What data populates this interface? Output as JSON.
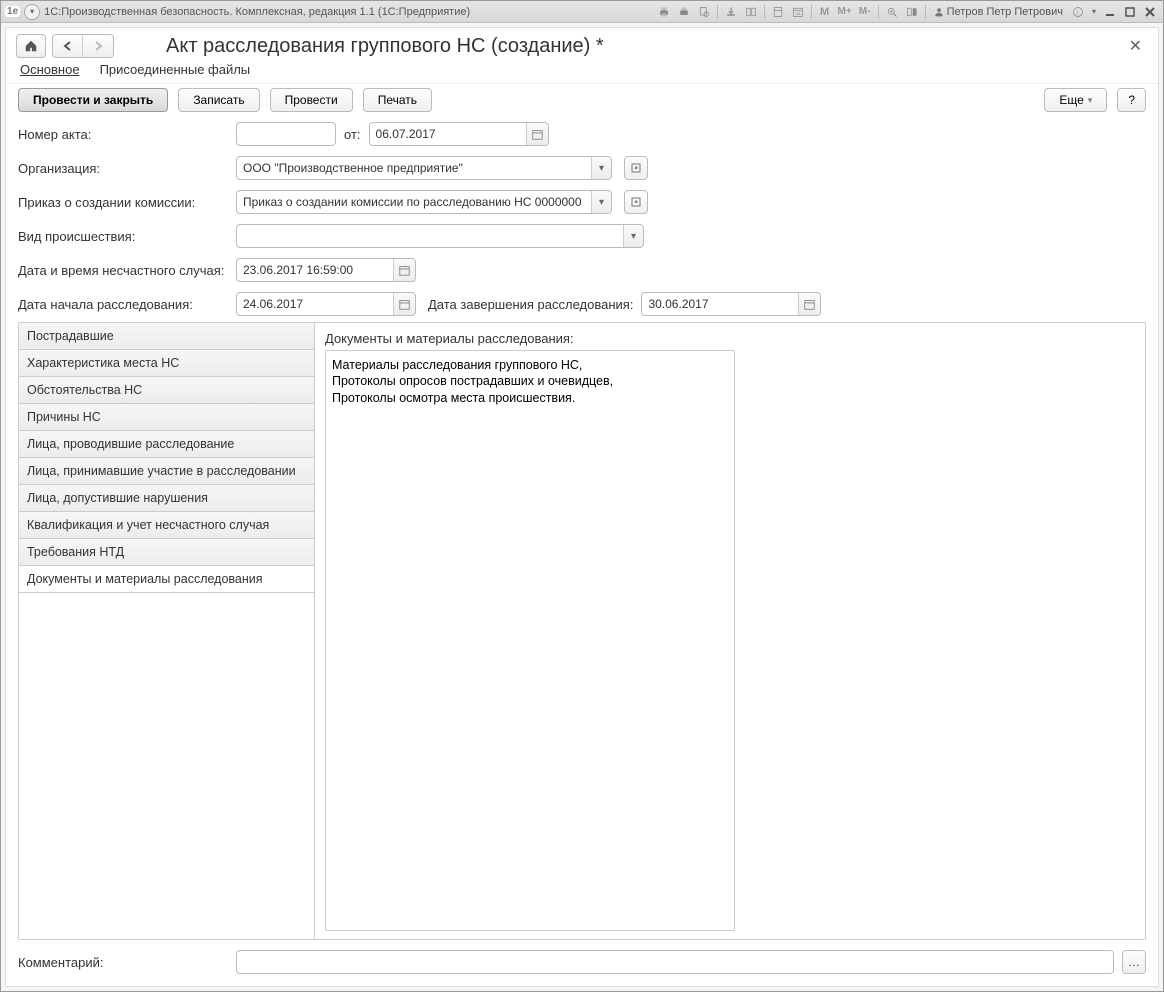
{
  "titlebar": {
    "app_title": "1С:Производственная безопасность. Комплексная, редакция 1.1  (1С:Предприятие)",
    "user_name": "Петров Петр Петрович",
    "m1": "M",
    "m2": "M+",
    "m3": "M-"
  },
  "page": {
    "title": "Акт расследования группового НС (создание) *"
  },
  "section_tabs": {
    "main": "Основное",
    "files": "Присоединенные файлы"
  },
  "toolbar": {
    "post_close": "Провести и закрыть",
    "save": "Записать",
    "post": "Провести",
    "print": "Печать",
    "more": "Еще",
    "help": "?"
  },
  "form": {
    "act_number_label": "Номер акта:",
    "act_number_value": "",
    "from_label": "от:",
    "from_date": "06.07.2017",
    "org_label": "Организация:",
    "org_value": "ООО \"Производственное предприятие\"",
    "order_label": "Приказ о создании комиссии:",
    "order_value": "Приказ о создании комиссии по расследованию НС 0000000",
    "incident_type_label": "Вид происшествия:",
    "incident_type_value": "",
    "datetime_label": "Дата и время несчастного случая:",
    "datetime_value": "23.06.2017 16:59:00",
    "start_label": "Дата начала расследования:",
    "start_value": "24.06.2017",
    "end_label": "Дата завершения расследования:",
    "end_value": "30.06.2017"
  },
  "tabs": [
    "Пострадавшие",
    "Характеристика места НС",
    "Обстоятельства НС",
    "Причины НС",
    "Лица, проводившие расследование",
    "Лица, принимавшие участие в расследовании",
    "Лица, допустившие нарушения",
    "Квалификация и учет несчастного случая",
    "Требования НТД",
    "Документы и материалы расследования"
  ],
  "active_tab_index": 9,
  "panel": {
    "label": "Документы и материалы расследования:",
    "text": "Материалы расследования группового НС,\nПротоколы опросов пострадавших и очевидцев,\nПротоколы осмотра места происшествия."
  },
  "comment": {
    "label": "Комментарий:",
    "value": ""
  }
}
